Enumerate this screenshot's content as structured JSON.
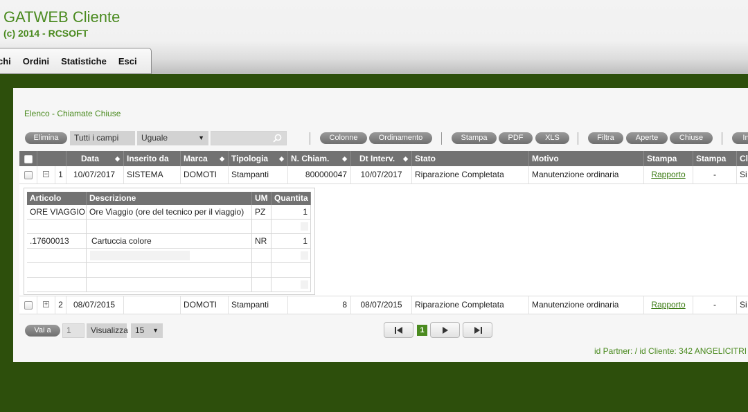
{
  "header": {
    "app_title": "GATWEB Cliente",
    "copyright": "(c) 2014 - RCSOFT"
  },
  "menu": [
    "chi",
    "Ordini",
    "Statistiche",
    "Esci"
  ],
  "section_title": "Elenco - Chiamate Chiuse",
  "toolbar": {
    "elimina": "Elimina",
    "field_select": "Tutti i campi",
    "op_select": "Uguale",
    "search_value": "",
    "colonne": "Colonne",
    "ordinamento": "Ordinamento",
    "stampa": "Stampa",
    "pdf": "PDF",
    "xls": "XLS",
    "filtra": "Filtra",
    "aperte": "Aperte",
    "chiuse": "Chiuse",
    "more": "In"
  },
  "columns": [
    "Data",
    "Inserito da",
    "Marca",
    "Tipologia",
    "N. Chiam.",
    "Dt Interv.",
    "Stato",
    "Motivo",
    "Stampa",
    "Stampa",
    "Cl"
  ],
  "rows": [
    {
      "n": "1",
      "data": "10/07/2017",
      "inserito": "SISTEMA",
      "marca": "DOMOTI",
      "tipologia": "Stampanti",
      "nchiam": "800000047",
      "dtinterv": "10/07/2017",
      "stato": "Riparazione Completata",
      "motivo": "Manutenzione ordinaria",
      "stampa1": "Rapporto",
      "stampa2": "-",
      "cl": "Si",
      "expand": "−"
    },
    {
      "n": "2",
      "data": "08/07/2015",
      "inserito": "",
      "marca": "DOMOTI",
      "tipologia": "Stampanti",
      "nchiam": "8",
      "dtinterv": "08/07/2015",
      "stato": "Riparazione Completata",
      "motivo": "Manutenzione ordinaria",
      "stampa1": "Rapporto",
      "stampa2": "-",
      "cl": "Si",
      "expand": "+"
    }
  ],
  "detail": {
    "columns": [
      "Articolo",
      "Descrizione",
      "UM",
      "Quantita"
    ],
    "items": [
      {
        "articolo": "ORE VIAGGIO",
        "descrizione": "Ore Viaggio (ore del tecnico per il viaggio)",
        "um": "PZ",
        "qta": "1"
      },
      {
        "articolo": ".17600013",
        "descrizione": "Cartuccia colore",
        "um": "NR",
        "qta": "1"
      }
    ]
  },
  "pager": {
    "vai_a": "Vai a",
    "page_input": "1",
    "visualizza": "Visualizza",
    "page_size": "15",
    "current_page": "1"
  },
  "footer_id": "id Partner: / id Cliente: 342 ANGELICITRI"
}
